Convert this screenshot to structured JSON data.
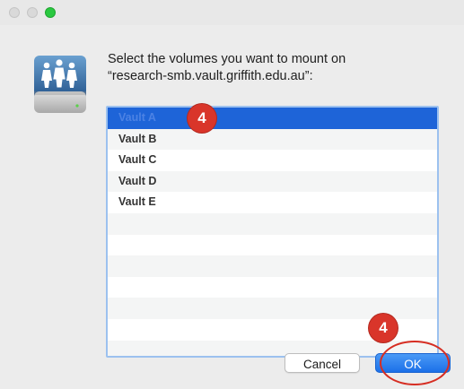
{
  "dialog": {
    "prompt": "Select the volumes you want to mount on\n“research-smb.vault.griffith.edu.au”:",
    "volumes": [
      {
        "label": "Vault A",
        "selected": true
      },
      {
        "label": "Vault B"
      },
      {
        "label": "Vault C"
      },
      {
        "label": "Vault D"
      },
      {
        "label": "Vault E"
      },
      {
        "label": ""
      },
      {
        "label": ""
      },
      {
        "label": ""
      },
      {
        "label": ""
      },
      {
        "label": ""
      },
      {
        "label": ""
      },
      {
        "label": ""
      }
    ],
    "cancel_label": "Cancel",
    "ok_label": "OK"
  },
  "annotations": {
    "step_badge_list": "4",
    "step_badge_ok": "4"
  },
  "icons": {
    "window_zoom": "green-zoom-button-icon",
    "server": "network-server-drive-icon"
  },
  "colors": {
    "selection": "#1e64d8",
    "ok_button": "#1c70e8",
    "annotation": "#d9352a"
  }
}
